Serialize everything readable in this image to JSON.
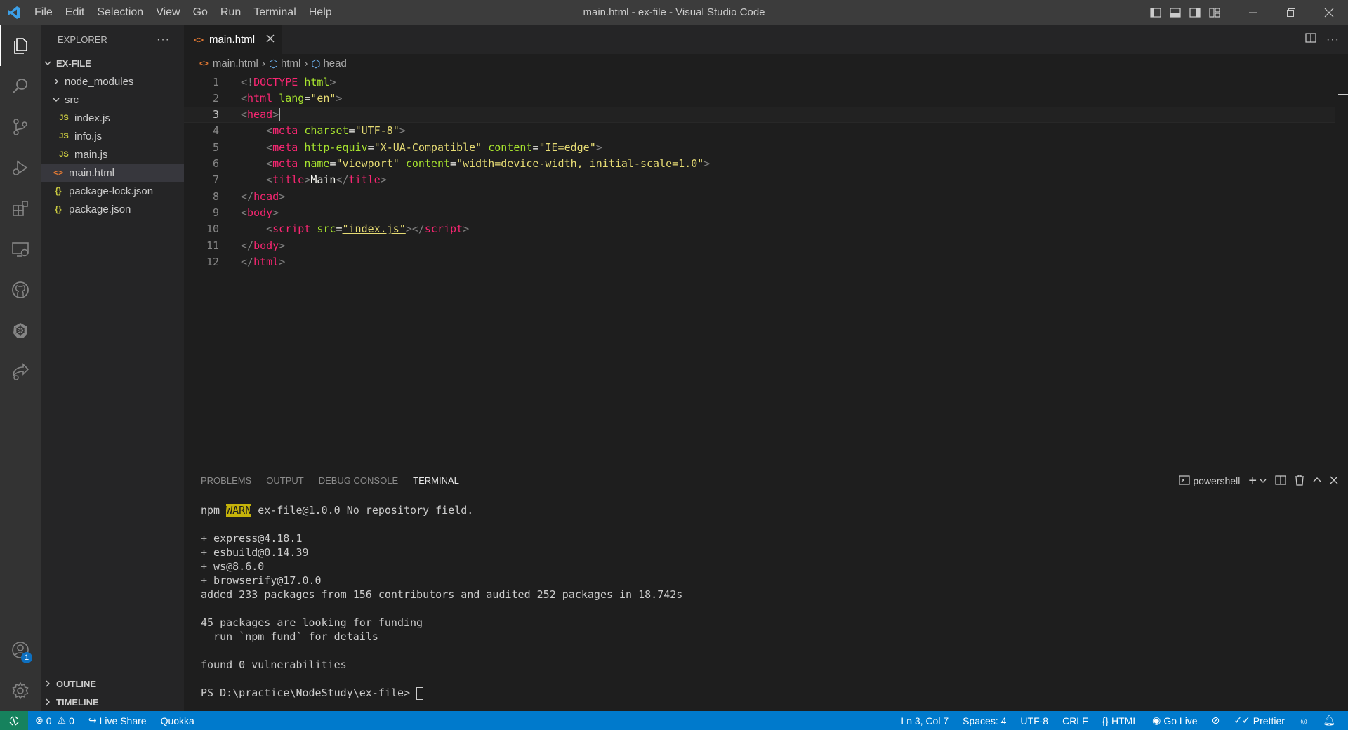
{
  "app": {
    "window_title": "main.html - ex-file - Visual Studio Code",
    "logo_icon": "vscode-logo-icon",
    "accent": "#007acc"
  },
  "menu": [
    "File",
    "Edit",
    "Selection",
    "View",
    "Go",
    "Run",
    "Terminal",
    "Help"
  ],
  "activity_bar": {
    "items": [
      "explorer-icon",
      "search-icon",
      "source-control-icon",
      "run-debug-icon",
      "extensions-icon",
      "remote-explorer-icon",
      "github-icon",
      "kubernetes-icon",
      "live-share-icon"
    ],
    "accounts_badge": "1"
  },
  "sidebar": {
    "title": "EXPLORER",
    "root": "EX-FILE",
    "tree": [
      {
        "label": "node_modules",
        "type": "folder",
        "expanded": false,
        "depth": 1
      },
      {
        "label": "src",
        "type": "folder",
        "expanded": true,
        "depth": 1
      },
      {
        "label": "index.js",
        "type": "js",
        "depth": 2
      },
      {
        "label": "info.js",
        "type": "js",
        "depth": 2
      },
      {
        "label": "main.js",
        "type": "js",
        "depth": 2
      },
      {
        "label": "main.html",
        "type": "html",
        "depth": 1,
        "selected": true
      },
      {
        "label": "package-lock.json",
        "type": "json",
        "depth": 1
      },
      {
        "label": "package.json",
        "type": "json",
        "depth": 1
      }
    ],
    "outline": "OUTLINE",
    "timeline": "TIMELINE"
  },
  "tabs": [
    {
      "label": "main.html",
      "active": true
    }
  ],
  "breadcrumb": [
    "main.html",
    "html",
    "head"
  ],
  "editor": {
    "current_line": 3,
    "lines": [
      [
        [
          "b",
          "<!"
        ],
        [
          "k",
          "DOCTYPE"
        ],
        [
          "p",
          " "
        ],
        [
          "a",
          "html"
        ],
        [
          "b",
          ">"
        ]
      ],
      [
        [
          "b",
          "<"
        ],
        [
          "k",
          "html"
        ],
        [
          "p",
          " "
        ],
        [
          "a",
          "lang"
        ],
        [
          "p",
          "="
        ],
        [
          "s",
          "\"en\""
        ],
        [
          "b",
          ">"
        ]
      ],
      [
        [
          "b",
          "<"
        ],
        [
          "k",
          "head"
        ],
        [
          "b",
          ">"
        ],
        [
          "cursor",
          ""
        ]
      ],
      [
        [
          "p",
          "    "
        ],
        [
          "b",
          "<"
        ],
        [
          "k",
          "meta"
        ],
        [
          "p",
          " "
        ],
        [
          "a",
          "charset"
        ],
        [
          "p",
          "="
        ],
        [
          "s",
          "\"UTF-8\""
        ],
        [
          "b",
          ">"
        ]
      ],
      [
        [
          "p",
          "    "
        ],
        [
          "b",
          "<"
        ],
        [
          "k",
          "meta"
        ],
        [
          "p",
          " "
        ],
        [
          "a",
          "http-equiv"
        ],
        [
          "p",
          "="
        ],
        [
          "s",
          "\"X-UA-Compatible\""
        ],
        [
          "p",
          " "
        ],
        [
          "a",
          "content"
        ],
        [
          "p",
          "="
        ],
        [
          "s",
          "\"IE=edge\""
        ],
        [
          "b",
          ">"
        ]
      ],
      [
        [
          "p",
          "    "
        ],
        [
          "b",
          "<"
        ],
        [
          "k",
          "meta"
        ],
        [
          "p",
          " "
        ],
        [
          "a",
          "name"
        ],
        [
          "p",
          "="
        ],
        [
          "s",
          "\"viewport\""
        ],
        [
          "p",
          " "
        ],
        [
          "a",
          "content"
        ],
        [
          "p",
          "="
        ],
        [
          "s",
          "\"width=device-width, initial-scale=1.0\""
        ],
        [
          "b",
          ">"
        ]
      ],
      [
        [
          "p",
          "    "
        ],
        [
          "b",
          "<"
        ],
        [
          "k",
          "title"
        ],
        [
          "b",
          ">"
        ],
        [
          "t",
          "Main"
        ],
        [
          "b",
          "</"
        ],
        [
          "k",
          "title"
        ],
        [
          "b",
          ">"
        ]
      ],
      [
        [
          "b",
          "</"
        ],
        [
          "k",
          "head"
        ],
        [
          "b",
          ">"
        ]
      ],
      [
        [
          "b",
          "<"
        ],
        [
          "k",
          "body"
        ],
        [
          "b",
          ">"
        ]
      ],
      [
        [
          "p",
          "    "
        ],
        [
          "b",
          "<"
        ],
        [
          "k",
          "script"
        ],
        [
          "p",
          " "
        ],
        [
          "a",
          "src"
        ],
        [
          "p",
          "="
        ],
        [
          "s",
          "\"index.js\""
        ],
        [
          "b",
          "></"
        ],
        [
          "k",
          "script"
        ],
        [
          "b",
          ">"
        ]
      ],
      [
        [
          "b",
          "</"
        ],
        [
          "k",
          "body"
        ],
        [
          "b",
          ">"
        ]
      ],
      [
        [
          "b",
          "</"
        ],
        [
          "k",
          "html"
        ],
        [
          "b",
          ">"
        ]
      ]
    ]
  },
  "panel": {
    "tabs": [
      "PROBLEMS",
      "OUTPUT",
      "DEBUG CONSOLE",
      "TERMINAL"
    ],
    "active_tab": "TERMINAL",
    "shell": "powershell",
    "terminal_lines": [
      {
        "pre": "npm ",
        "warn": "WARN",
        "post": " ex-file@1.0.0 No repository field."
      },
      {
        "gap": true
      },
      {
        "text": "+ express@4.18.1"
      },
      {
        "text": "+ esbuild@0.14.39"
      },
      {
        "text": "+ ws@8.6.0"
      },
      {
        "text": "+ browserify@17.0.0"
      },
      {
        "text": "added 233 packages from 156 contributors and audited 252 packages in 18.742s"
      },
      {
        "gap": true
      },
      {
        "text": "45 packages are looking for funding"
      },
      {
        "text": "  run `npm fund` for details"
      },
      {
        "gap": true
      },
      {
        "text": "found 0 vulnerabilities"
      },
      {
        "gap": true
      },
      {
        "text": "PS D:\\practice\\NodeStudy\\ex-file> ",
        "cursor": true
      }
    ]
  },
  "statusbar": {
    "errors": "0",
    "warnings": "0",
    "live_share": "Live Share",
    "quokka": "Quokka",
    "position": "Ln 3, Col 7",
    "spaces": "Spaces: 4",
    "encoding": "UTF-8",
    "eol": "CRLF",
    "language": "HTML",
    "go_live": "Go Live",
    "prettier": "Prettier"
  }
}
